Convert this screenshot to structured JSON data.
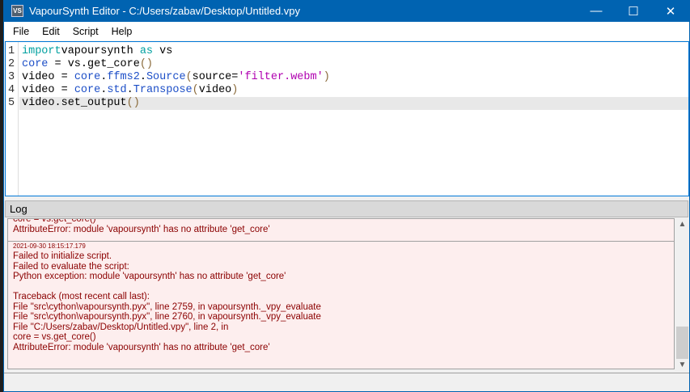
{
  "window": {
    "title": "VapourSynth Editor - C:/Users/zabav/Desktop/Untitled.vpy",
    "icon_text": "VS",
    "minimize": "—",
    "maximize": "☐",
    "close": "✕"
  },
  "menu": [
    "File",
    "Edit",
    "Script",
    "Help"
  ],
  "editor": {
    "lines": [
      {
        "n": "1",
        "tokens": [
          [
            "kw",
            "import"
          ],
          [
            "",
            "vapoursynth "
          ],
          [
            "kw",
            "as"
          ],
          [
            "",
            " vs"
          ]
        ]
      },
      {
        "n": "2",
        "tokens": [
          [
            "id",
            "core"
          ],
          [
            "",
            " = vs.get_core"
          ],
          [
            "br",
            "()"
          ]
        ]
      },
      {
        "n": "3",
        "tokens": [
          [
            "",
            "video = "
          ],
          [
            "id",
            "core"
          ],
          [
            "",
            "."
          ],
          [
            "id",
            "ffms2"
          ],
          [
            "",
            "."
          ],
          [
            "id",
            "Source"
          ],
          [
            "br",
            "("
          ],
          [
            "",
            "source="
          ],
          [
            "st",
            "'filter.webm'"
          ],
          [
            "br",
            ")"
          ]
        ]
      },
      {
        "n": "4",
        "tokens": [
          [
            "",
            "video = "
          ],
          [
            "id",
            "core"
          ],
          [
            "",
            "."
          ],
          [
            "id",
            "std"
          ],
          [
            "",
            "."
          ],
          [
            "id",
            "Transpose"
          ],
          [
            "br",
            "("
          ],
          [
            "",
            "video"
          ],
          [
            "br",
            ")"
          ]
        ]
      },
      {
        "n": "5",
        "tokens": [
          [
            "",
            "video.set_output"
          ],
          [
            "br",
            "()"
          ]
        ]
      }
    ]
  },
  "log": {
    "title": "Log",
    "entries": [
      {
        "timestamp": "",
        "lines": [
          "core = vs.get_core()",
          "AttributeError: module 'vapoursynth' has no attribute 'get_core'"
        ]
      },
      {
        "timestamp": "2021-09-30 18:15:17.179",
        "lines": [
          "Failed to initialize script.",
          "Failed to evaluate the script:",
          "Python exception: module 'vapoursynth' has no attribute 'get_core'",
          "",
          "Traceback (most recent call last):",
          "File \"src\\cython\\vapoursynth.pyx\", line 2759, in vapoursynth._vpy_evaluate",
          "File \"src\\cython\\vapoursynth.pyx\", line 2760, in vapoursynth._vpy_evaluate",
          "File \"C:/Users/zabav/Desktop/Untitled.vpy\", line 2, in",
          "core = vs.get_core()",
          "AttributeError: module 'vapoursynth' has no attribute 'get_core'"
        ]
      }
    ]
  }
}
